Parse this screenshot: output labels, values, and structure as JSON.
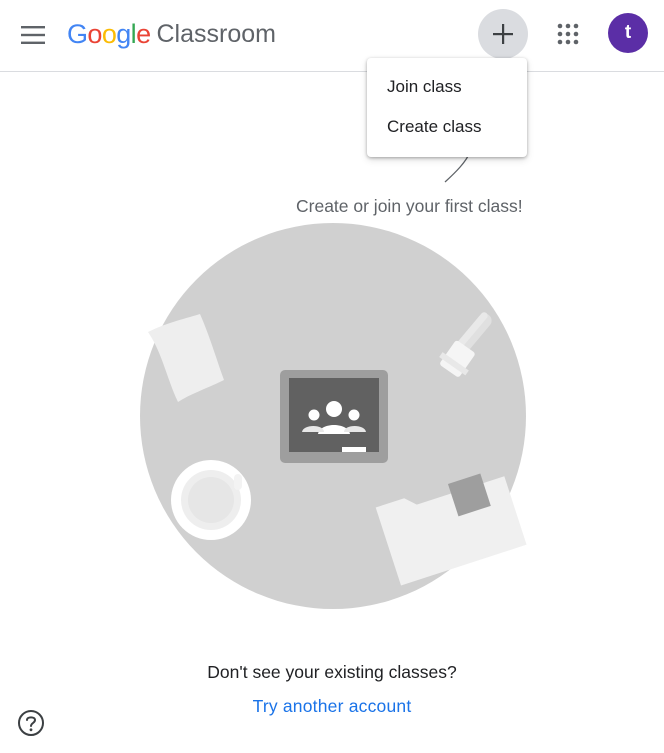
{
  "header": {
    "logo": {
      "google_letters": [
        {
          "char": "G",
          "color": "#4285F4"
        },
        {
          "char": "o",
          "color": "#EA4335"
        },
        {
          "char": "o",
          "color": "#FBBC05"
        },
        {
          "char": "g",
          "color": "#4285F4"
        },
        {
          "char": "l",
          "color": "#34A853"
        },
        {
          "char": "e",
          "color": "#EA4335"
        }
      ],
      "product": "Classroom"
    },
    "menu_icon": "hamburger-menu-icon",
    "plus_icon": "plus-icon",
    "apps_icon": "apps-grid-icon",
    "avatar": {
      "letter": "t",
      "color": "#5B2EA6"
    }
  },
  "add_menu": {
    "items": [
      "Join class",
      "Create class"
    ]
  },
  "empty_state": {
    "hint": "Create or join your first class!",
    "prompt": "Don't see your existing classes?",
    "link": "Try another account"
  },
  "colors": {
    "link": "#1A73E8",
    "illustration_bg": "#CFCFCF"
  },
  "footer": {
    "help_icon": "help-icon"
  }
}
